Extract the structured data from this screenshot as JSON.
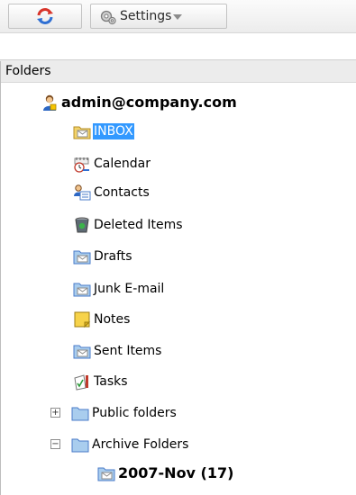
{
  "toolbar": {
    "refresh_icon": "refresh-icon",
    "settings_icon": "gear-icon",
    "settings_label": "Settings"
  },
  "panel": {
    "header": "Folders"
  },
  "tree": {
    "account": "admin@company.com",
    "items": [
      {
        "label": "INBOX",
        "icon": "inbox-folder-icon",
        "selected": true
      },
      {
        "label": "Calendar",
        "icon": "calendar-icon"
      },
      {
        "label": "Contacts",
        "icon": "contacts-icon"
      },
      {
        "label": "Deleted Items",
        "icon": "trash-icon"
      },
      {
        "label": "Drafts",
        "icon": "folder-icon"
      },
      {
        "label": "Junk E-mail",
        "icon": "folder-icon"
      },
      {
        "label": "Notes",
        "icon": "notes-icon"
      },
      {
        "label": "Sent Items",
        "icon": "folder-icon"
      },
      {
        "label": "Tasks",
        "icon": "tasks-icon"
      }
    ],
    "public_folders": "Public folders",
    "archive_folders": "Archive Folders",
    "archive_child": "2007-Nov (17)"
  },
  "colors": {
    "selection": "#3399ff",
    "folder_blue": "#5aa0d6"
  }
}
